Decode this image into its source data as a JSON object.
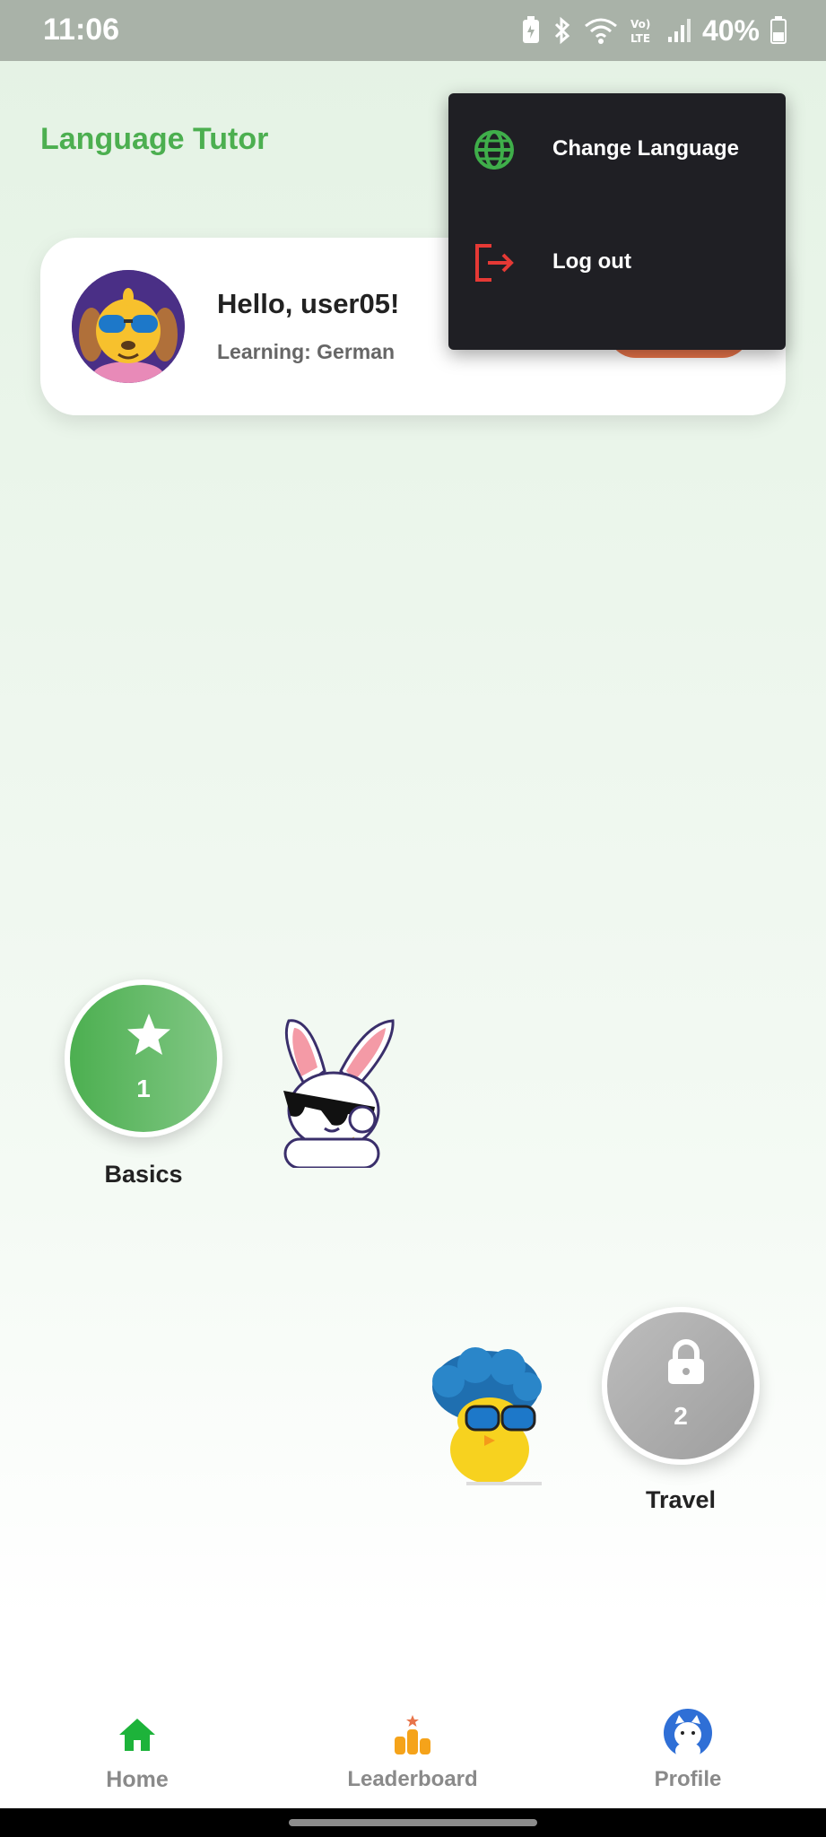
{
  "status_bar": {
    "time": "11:06",
    "battery": "40%",
    "icons": [
      "battery-saver-icon",
      "bluetooth-icon",
      "wifi-icon",
      "volte-icon",
      "signal-icon",
      "battery-icon"
    ]
  },
  "app": {
    "title": "Language Tutor",
    "title_color": "#4caf50"
  },
  "greeting_card": {
    "greeting": "Hello, user05!",
    "learning": "Learning: German",
    "avatar": "dog-with-sunglasses-avatar",
    "action_button_color": "#e8744a"
  },
  "menu": {
    "items": [
      {
        "label": "Change Language",
        "icon": "globe-icon",
        "icon_color": "#3fae4a"
      },
      {
        "label": "Log out",
        "icon": "logout-icon",
        "icon_color": "#e53935"
      }
    ]
  },
  "lessons": [
    {
      "number": "1",
      "label": "Basics",
      "locked": false,
      "icon": "star-icon"
    },
    {
      "number": "2",
      "label": "Travel",
      "locked": true,
      "icon": "lock-icon"
    }
  ],
  "mascots": [
    "bunny-with-sunglasses",
    "chick-with-afro-and-sunglasses"
  ],
  "bottom_nav": {
    "items": [
      {
        "label": "Home",
        "icon": "home-icon",
        "active": true
      },
      {
        "label": "Leaderboard",
        "icon": "leaderboard-icon",
        "active": false
      },
      {
        "label": "Profile",
        "icon": "profile-avatar-icon",
        "active": false
      }
    ],
    "active_color": "#1db33a"
  }
}
